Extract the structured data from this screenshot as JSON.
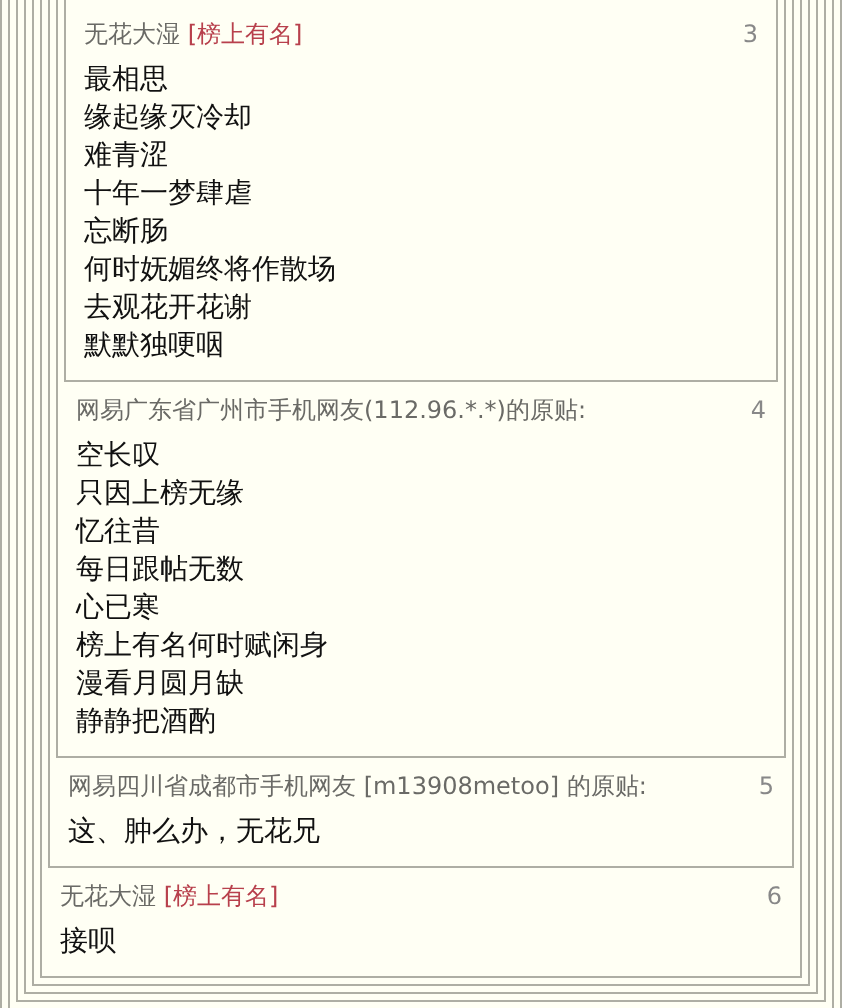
{
  "floors": [
    {
      "number": "3",
      "author": "无花大湿",
      "tag": "[榜上有名]",
      "lines": [
        "最相思",
        "缘起缘灭冷却",
        "难青涩",
        "十年一梦肆虐",
        "忘断肠",
        "何时妩媚终将作散场",
        "去观花开花谢",
        "默默独哽咽"
      ]
    },
    {
      "number": "4",
      "author": "网易广东省广州市手机网友(112.96.*.*)的原贴:",
      "lines": [
        "空长叹",
        "只因上榜无缘",
        "忆往昔",
        "每日跟帖无数",
        "心已寒",
        "榜上有名何时赋闲身",
        "漫看月圆月缺",
        "静静把酒酌"
      ]
    },
    {
      "number": "5",
      "author": "网易四川省成都市手机网友 [m13908metoo] 的原贴:",
      "lines": [
        "这、肿么办，无花兄"
      ]
    },
    {
      "number": "6",
      "author": "无花大湿",
      "tag": "[榜上有名]",
      "lines": [
        "接呗"
      ]
    }
  ]
}
